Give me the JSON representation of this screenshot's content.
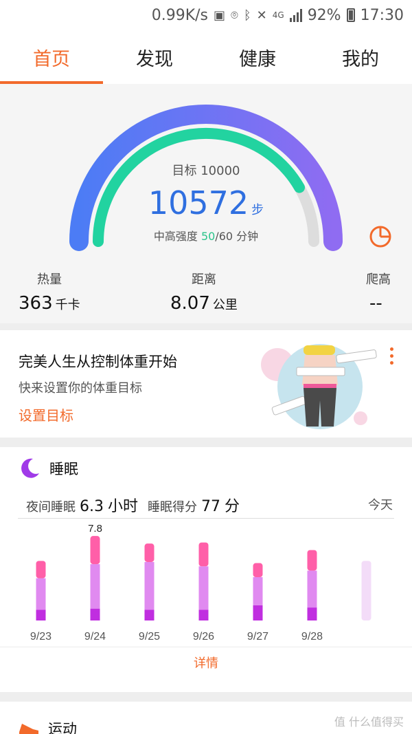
{
  "status_bar": {
    "speed": "0.99K/s",
    "network": "4G",
    "battery": "92%",
    "time": "17:30"
  },
  "tabs": [
    {
      "label": "首页",
      "active": true
    },
    {
      "label": "发现",
      "active": false
    },
    {
      "label": "健康",
      "active": false
    },
    {
      "label": "我的",
      "active": false
    }
  ],
  "steps": {
    "goal_label": "目标 10000",
    "count": "10572",
    "unit": "步",
    "intensity_prefix": "中高强度 ",
    "intensity_value": "50",
    "intensity_suffix": "/60 分钟",
    "goal_progress": 1.0,
    "intensity_progress": 0.8333
  },
  "stats": {
    "calories": {
      "label": "热量",
      "value": "363",
      "unit": "千卡"
    },
    "distance": {
      "label": "距离",
      "value": "8.07",
      "unit": "公里"
    },
    "climb": {
      "label": "爬高",
      "value": "--"
    }
  },
  "weight": {
    "title": "完美人生从控制体重开始",
    "subtitle": "快来设置你的体重目标",
    "link": "设置目标"
  },
  "sleep": {
    "title": "睡眠",
    "night_label": "夜间睡眠",
    "night_value": "6.3",
    "night_unit": "小时",
    "score_label": "睡眠得分",
    "score_value": "77",
    "score_unit": "分",
    "today_label": "今天",
    "detail": "详情"
  },
  "sport": {
    "title": "运动"
  },
  "watermark": "值 什么值得买",
  "colors": {
    "accent": "#f26a2b",
    "gauge_outer_start": "#4c7cf5",
    "gauge_outer_end": "#8f6cf2",
    "gauge_inner": "#22d3a0",
    "gauge_track": "#dddddd",
    "steps_text": "#2f6fe0",
    "sleep_awake": "#ff5fa8",
    "sleep_light": "#e08af0",
    "sleep_deep": "#c02ee0",
    "sleep_today": "#f3dcf8"
  },
  "chart_data": {
    "type": "bar",
    "categories": [
      "9/23",
      "9/24",
      "9/25",
      "9/26",
      "9/27",
      "9/28",
      "今天"
    ],
    "annotations": [
      "7.8"
    ],
    "series": [
      {
        "name": "deep",
        "values": [
          1.0,
          1.1,
          1.0,
          1.0,
          1.4,
          1.2,
          0
        ]
      },
      {
        "name": "light",
        "values": [
          2.9,
          4.1,
          4.4,
          4.0,
          2.6,
          3.4,
          0
        ]
      },
      {
        "name": "awake",
        "values": [
          1.6,
          2.6,
          1.7,
          2.2,
          1.3,
          1.9,
          0
        ]
      },
      {
        "name": "today",
        "values": [
          0,
          0,
          0,
          0,
          0,
          0,
          5.5
        ]
      }
    ],
    "totals": [
      5.5,
      7.8,
      7.1,
      7.2,
      5.3,
      6.5,
      5.5
    ],
    "ylim": [
      0,
      8
    ]
  }
}
